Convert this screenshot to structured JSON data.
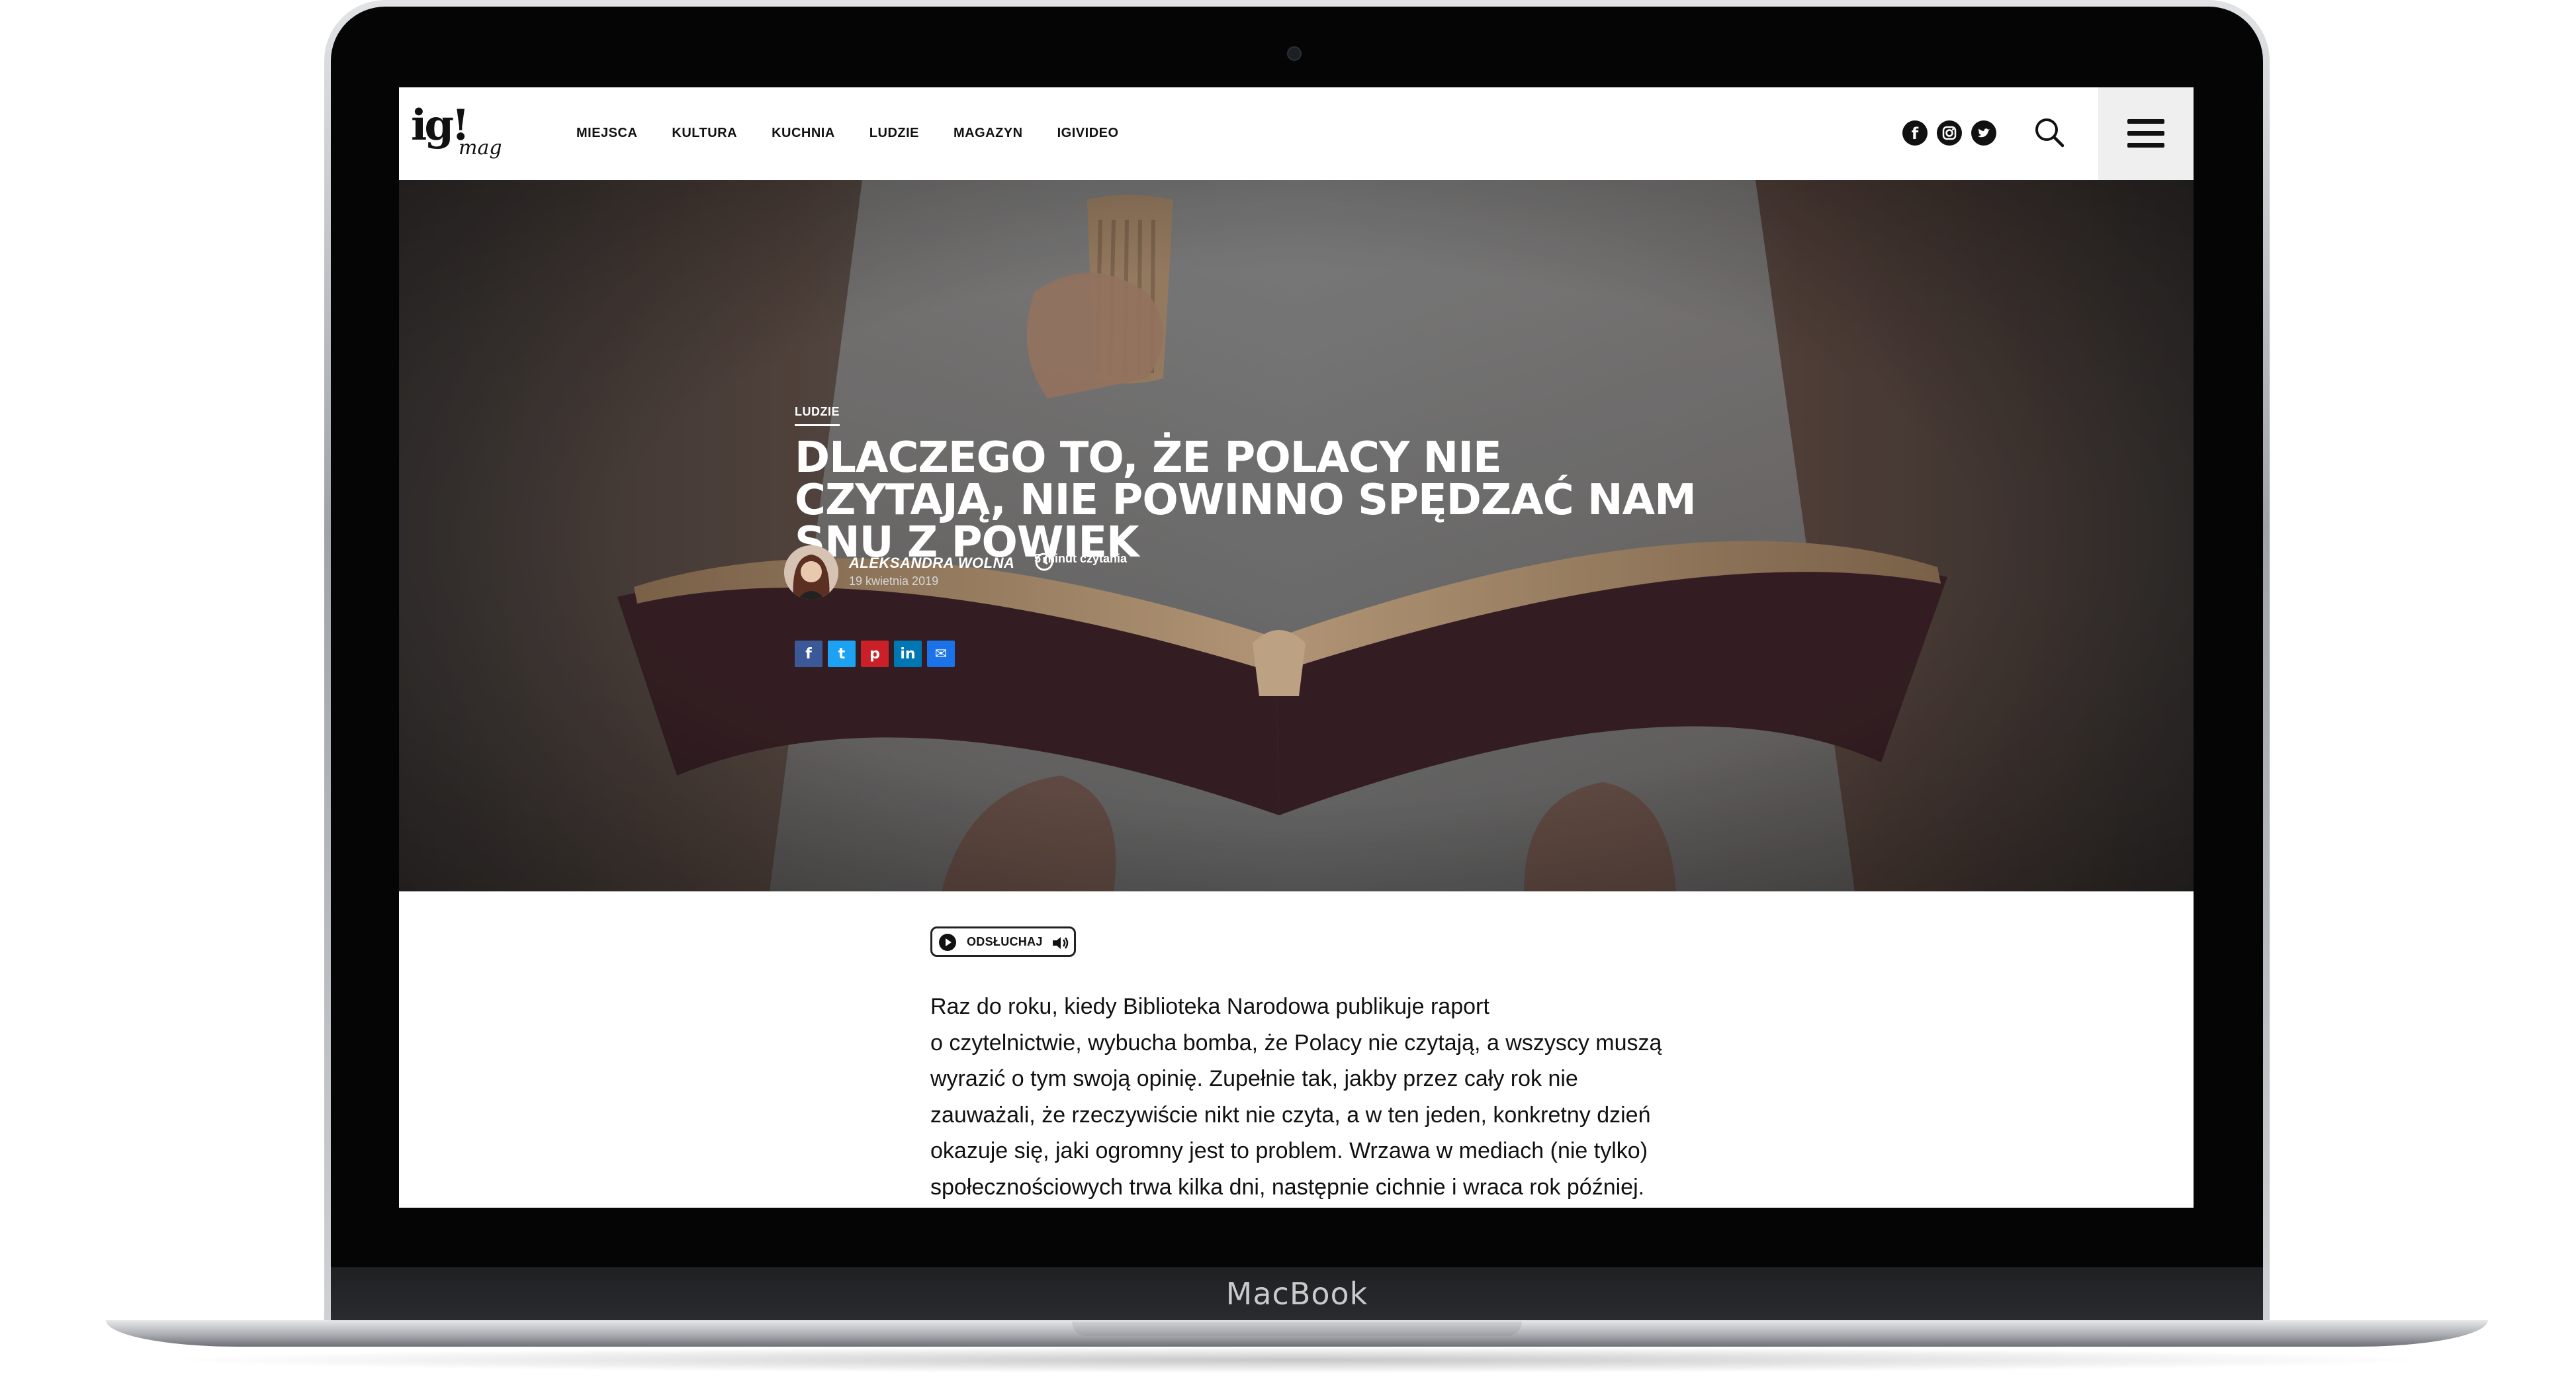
{
  "device": {
    "brand": "MacBook"
  },
  "header": {
    "logo": {
      "main": "ig!",
      "sub": "mag"
    },
    "nav": [
      "MIEJSCA",
      "KULTURA",
      "KUCHNIA",
      "LUDZIE",
      "MAGAZYN",
      "IGIVIDEO"
    ],
    "social": [
      "facebook-icon",
      "instagram-icon",
      "twitter-icon"
    ]
  },
  "hero": {
    "category": "LUDZIE",
    "title": "DLACZEGO TO, ŻE POLACY NIE CZYTAJĄ, NIE POWINNO SPĘDZAĆ NAM SNU Z POWIEK",
    "author": "ALEKSANDRA WOLNA",
    "date": "19 kwietnia 2019",
    "read_time": "5 minut czytania",
    "share": [
      {
        "icon": "facebook-icon",
        "glyph": "f",
        "color": "#3b5998"
      },
      {
        "icon": "twitter-icon",
        "glyph": "t",
        "color": "#1da1f2"
      },
      {
        "icon": "pinterest-icon",
        "glyph": "p",
        "color": "#cb2027"
      },
      {
        "icon": "linkedin-icon",
        "glyph": "in",
        "color": "#0077b5"
      },
      {
        "icon": "email-icon",
        "glyph": "✉",
        "color": "#1a73e8"
      }
    ]
  },
  "article": {
    "listen_label": "ODSŁUCHAJ",
    "lines": [
      "Raz do roku, kiedy Biblioteka Narodowa publikuje raport",
      "o czytelnictwie, wybucha bomba, że Polacy nie czytają, a wszyscy muszą",
      "wyrazić o tym  swoją opinię. Zupełnie tak, jakby przez cały rok nie",
      "zauważali, że rzeczywiście nikt nie czyta, a w ten jeden, konkretny dzień",
      "okazuje się, jaki ogromny jest to problem. Wrzawa w mediach (nie tylko)",
      "społecznościowych trwa kilka dni, następnie cichnie i wraca rok później."
    ]
  }
}
